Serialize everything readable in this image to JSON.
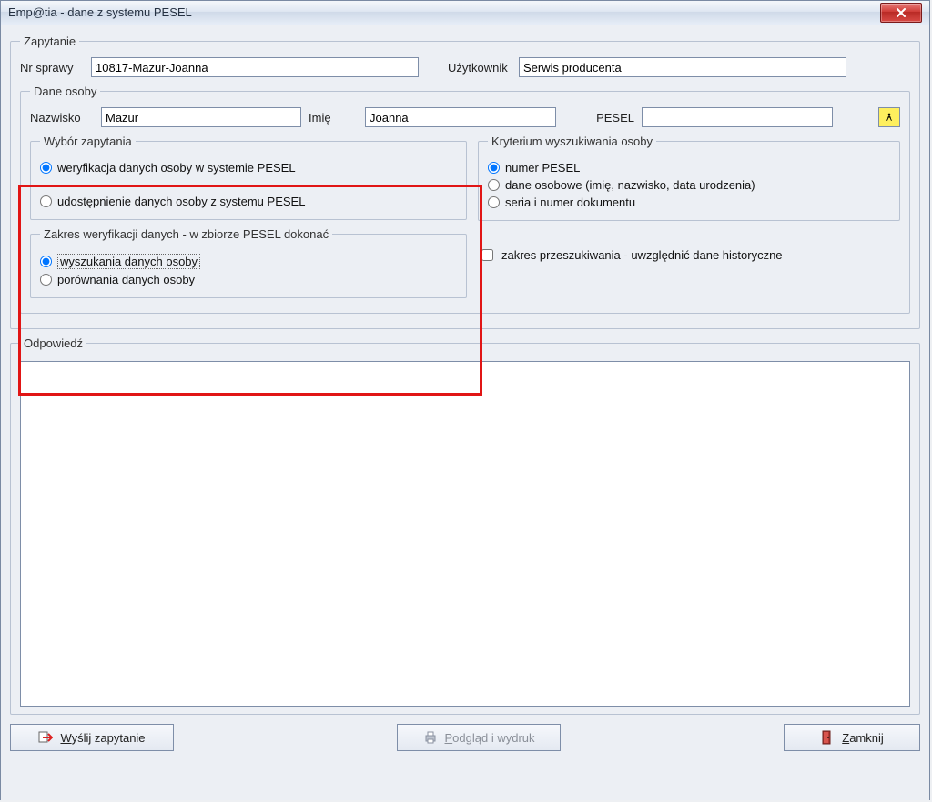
{
  "window": {
    "title": "Emp@tia - dane z systemu PESEL"
  },
  "zapytanie": {
    "legend": "Zapytanie",
    "nr_sprawy_label": "Nr sprawy",
    "nr_sprawy_value": "10817-Mazur-Joanna",
    "uzytkownik_label": "Użytkownik",
    "uzytkownik_value": "Serwis producenta"
  },
  "dane_osoby": {
    "legend": "Dane osoby",
    "nazwisko_label": "Nazwisko",
    "nazwisko_value": "Mazur",
    "imie_label": "Imię",
    "imie_value": "Joanna",
    "pesel_label": "PESEL",
    "pesel_value": ""
  },
  "wybor_zapytania": {
    "legend": "Wybór zapytania",
    "opt1": "weryfikacja danych osoby w systemie PESEL",
    "opt2": "udostępnienie danych osoby z systemu PESEL"
  },
  "zakres_weryfikacji": {
    "legend": "Zakres weryfikacji danych - w zbiorze PESEL dokonać",
    "opt1": "wyszukania danych osoby",
    "opt2": "porównania danych osoby"
  },
  "kryterium": {
    "legend": "Kryterium wyszukiwania osoby",
    "opt1": "numer PESEL",
    "opt2": "dane osobowe (imię, nazwisko, data urodzenia)",
    "opt3": "seria i numer dokumentu"
  },
  "zakres_checkbox_label": "zakres przeszukiwania - uwzględnić dane historyczne",
  "odpowiedz": {
    "legend": "Odpowiedź"
  },
  "buttons": {
    "send": "Wyślij zapytanie",
    "preview_prefix": "P",
    "preview_rest": "odgląd i wydruk",
    "close_prefix": "Z",
    "close_rest": "amknij"
  }
}
